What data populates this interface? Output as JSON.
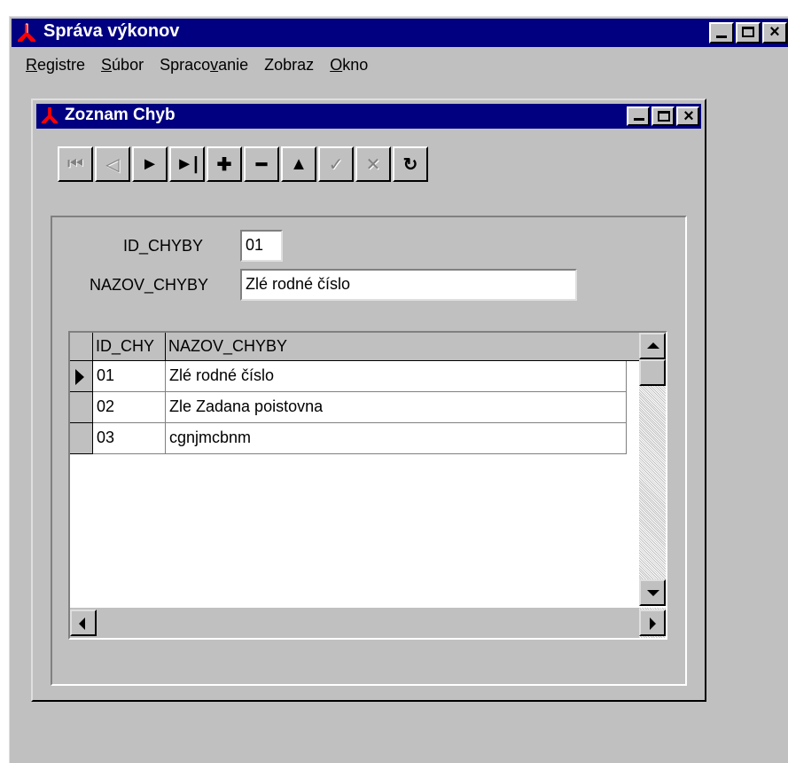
{
  "app": {
    "title": "Správa výkonov"
  },
  "menu": [
    {
      "pre": "",
      "u": "R",
      "post": "egistre"
    },
    {
      "pre": "",
      "u": "S",
      "post": "úbor"
    },
    {
      "pre": "Spraco",
      "u": "v",
      "post": "anie"
    },
    {
      "pre": "Zobraz",
      "u": "",
      "post": ""
    },
    {
      "pre": "",
      "u": "O",
      "post": "kno"
    }
  ],
  "child": {
    "title": "Zoznam Chyb",
    "toolbar": [
      {
        "name": "first-record-button",
        "glyph": "⏮",
        "enabled": false
      },
      {
        "name": "prior-record-button",
        "glyph": "◁",
        "enabled": false
      },
      {
        "name": "next-record-button",
        "glyph": "►",
        "enabled": true
      },
      {
        "name": "last-record-button",
        "glyph": "►|",
        "enabled": true
      },
      {
        "name": "insert-record-button",
        "glyph": "✚",
        "enabled": true
      },
      {
        "name": "delete-record-button",
        "glyph": "━",
        "enabled": true
      },
      {
        "name": "edit-record-button",
        "glyph": "▲",
        "enabled": true
      },
      {
        "name": "post-record-button",
        "glyph": "✓",
        "enabled": false
      },
      {
        "name": "cancel-edit-button",
        "glyph": "✕",
        "enabled": false
      },
      {
        "name": "refresh-button",
        "glyph": "↻",
        "enabled": true
      }
    ],
    "form": {
      "id_label": "ID_CHYBY",
      "id_value": "01",
      "name_label": "NAZOV_CHYBY",
      "name_value": "Zlé rodné číslo"
    },
    "grid": {
      "columns": [
        "ID_CHY",
        "NAZOV_CHYBY"
      ],
      "rows": [
        {
          "id": "01",
          "name": "Zlé rodné číslo",
          "current": true
        },
        {
          "id": "02",
          "name": "Zle Zadana poistovna",
          "current": false
        },
        {
          "id": "03",
          "name": "cgnjmcbnm",
          "current": false
        }
      ]
    }
  }
}
